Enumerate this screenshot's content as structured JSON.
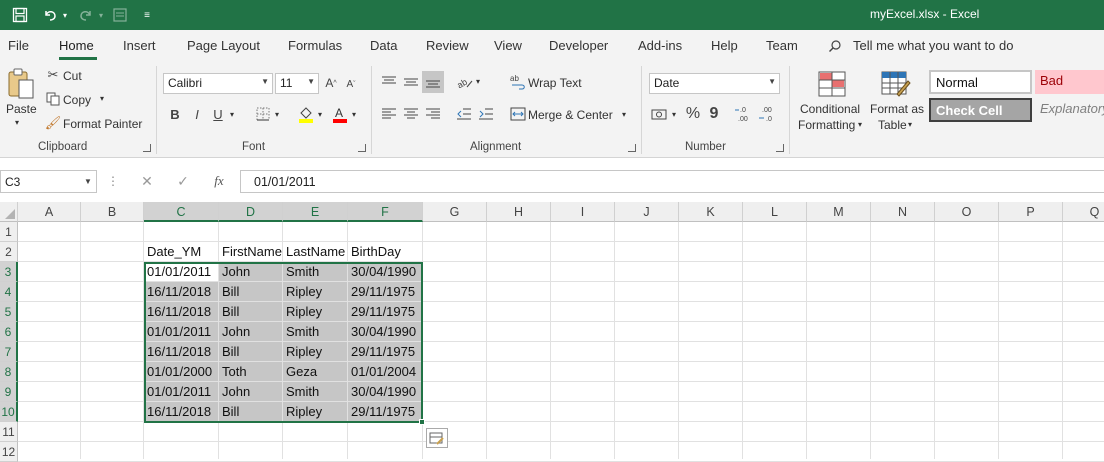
{
  "window": {
    "title": "myExcel.xlsx  -  Excel",
    "qat": {
      "save_icon": "save-icon",
      "undo_icon": "undo-icon",
      "redo_icon": "redo-icon",
      "customize_icon": "customize-qat-icon"
    }
  },
  "tabs": [
    "File",
    "Home",
    "Insert",
    "Page Layout",
    "Formulas",
    "Data",
    "Review",
    "View",
    "Developer",
    "Add-ins",
    "Help",
    "Team"
  ],
  "active_tab": "Home",
  "tell_me": "Tell me what you want to do",
  "ribbon": {
    "clipboard": {
      "label": "Clipboard",
      "paste": "Paste",
      "cut": "Cut",
      "copy": "Copy",
      "format_painter": "Format Painter"
    },
    "font": {
      "label": "Font",
      "font_name": "Calibri",
      "font_size": "11",
      "bold": "B",
      "italic": "I",
      "underline": "U"
    },
    "alignment": {
      "label": "Alignment",
      "wrap_text": "Wrap Text",
      "merge_center": "Merge & Center"
    },
    "number": {
      "label": "Number",
      "format": "Date",
      "percent": "%",
      "comma": "9"
    },
    "styles": {
      "conditional_formatting": "Conditional",
      "conditional_formatting_2": "Formatting",
      "format_as_table": "Format as",
      "format_as_table_2": "Table",
      "normal": "Normal",
      "bad": "Bad",
      "check_cell": "Check Cell",
      "explanatory": "Explanatory"
    }
  },
  "formula_bar": {
    "name_box": "C3",
    "fx_label": "fx",
    "content": "01/01/2011"
  },
  "grid": {
    "columns": [
      "A",
      "B",
      "C",
      "D",
      "E",
      "F",
      "G",
      "H",
      "I",
      "J",
      "K",
      "L",
      "M",
      "N",
      "O",
      "P",
      "Q"
    ],
    "rows": [
      "1",
      "2",
      "3",
      "4",
      "5",
      "6",
      "7",
      "8",
      "9",
      "10",
      "11",
      "12"
    ],
    "headers": [
      "Date_YM",
      "FirstName",
      "LastName",
      "BirthDay"
    ],
    "data": [
      [
        "01/01/2011",
        "John",
        "Smith",
        "30/04/1990"
      ],
      [
        "16/11/2018",
        "Bill",
        "Ripley",
        "29/11/1975"
      ],
      [
        "16/11/2018",
        "Bill",
        "Ripley",
        "29/11/1975"
      ],
      [
        "01/01/2011",
        "John",
        "Smith",
        "30/04/1990"
      ],
      [
        "16/11/2018",
        "Bill",
        "Ripley",
        "29/11/1975"
      ],
      [
        "01/01/2000",
        "Toth",
        "Geza",
        "01/01/2004"
      ],
      [
        "01/01/2011",
        "John",
        "Smith",
        "30/04/1990"
      ],
      [
        "16/11/2018",
        "Bill",
        "Ripley",
        "29/11/1975"
      ]
    ]
  },
  "colors": {
    "accent": "#217346",
    "selection_fill": "#c6c6c6",
    "bad_fill": "#ffc7ce",
    "bad_text": "#9c0006",
    "check_cell_fill": "#a5a5a5"
  }
}
